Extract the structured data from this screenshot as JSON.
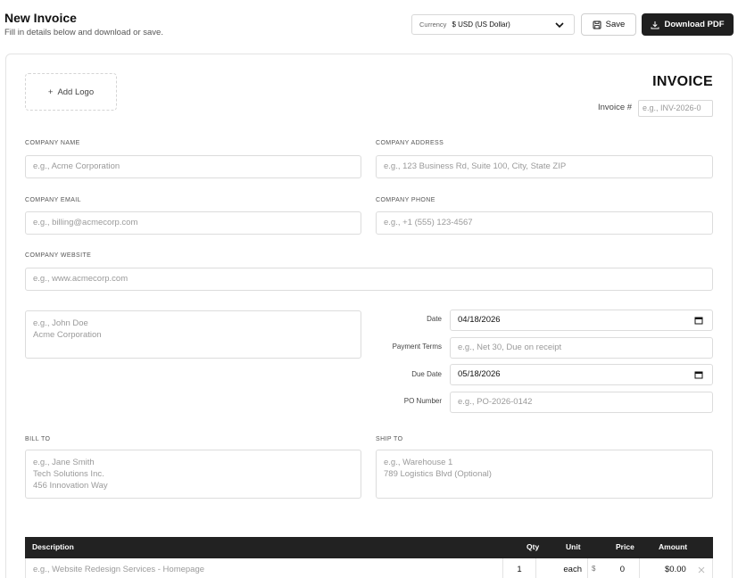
{
  "header": {
    "title": "New Invoice",
    "subtitle": "Fill in details below and download or save."
  },
  "toolbar": {
    "currency_label": "Currency",
    "currency_value": "$ USD (US Dollar)",
    "save_label": "Save",
    "download_label": "Download PDF"
  },
  "invoice": {
    "add_logo_label": "Add Logo",
    "title": "INVOICE",
    "number_label": "Invoice #",
    "number_placeholder": "e.g., INV-2026-0"
  },
  "company": {
    "name_label": "COMPANY NAME",
    "name_placeholder": "e.g., Acme Corporation",
    "address_label": "COMPANY ADDRESS",
    "address_placeholder": "e.g., 123 Business Rd, Suite 100, City, State ZIP",
    "email_label": "COMPANY EMAIL",
    "email_placeholder": "e.g., billing@acmecorp.com",
    "phone_label": "COMPANY PHONE",
    "phone_placeholder": "e.g., +1 (555) 123-4567",
    "website_label": "COMPANY WEBSITE",
    "website_placeholder": "e.g., www.acmecorp.com"
  },
  "from_placeholder": "e.g., John Doe\nAcme Corporation",
  "details": {
    "date_label": "Date",
    "date_value": "04/18/2026",
    "terms_label": "Payment Terms",
    "terms_placeholder": "e.g., Net 30, Due on receipt",
    "due_label": "Due Date",
    "due_value": "05/18/2026",
    "po_label": "PO Number",
    "po_placeholder": "e.g., PO-2026-0142"
  },
  "bill_to": {
    "label": "BILL TO",
    "placeholder": "e.g., Jane Smith\nTech Solutions Inc.\n456 Innovation Way"
  },
  "ship_to": {
    "label": "SHIP TO",
    "placeholder": "e.g., Warehouse 1\n789 Logistics Blvd (Optional)"
  },
  "items": {
    "headers": {
      "description": "Description",
      "qty": "Qty",
      "unit": "Unit",
      "price": "Price",
      "amount": "Amount"
    },
    "rows": [
      {
        "description_placeholder": "e.g., Website Redesign Services - Homepage",
        "qty": "1",
        "unit": "each",
        "currency_symbol": "$",
        "price": "0",
        "amount": "$0.00"
      }
    ]
  }
}
